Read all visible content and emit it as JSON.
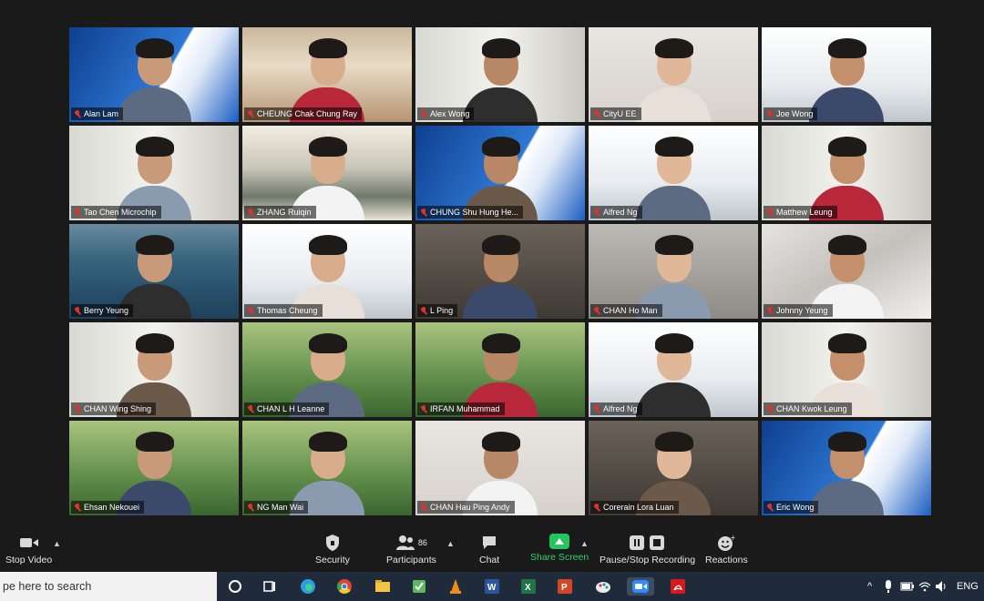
{
  "participants": [
    {
      "name": "Alan Lam",
      "bg": "ee",
      "active": true
    },
    {
      "name": "CHEUNG Chak Chung Ray",
      "bg": "shelf"
    },
    {
      "name": "Alex Wong",
      "bg": "office"
    },
    {
      "name": "CityU EE",
      "bg": "wall"
    },
    {
      "name": "Joe Wong",
      "bg": "window"
    },
    {
      "name": "Tao Chen  Microchip",
      "bg": "office"
    },
    {
      "name": "ZHANG Ruiqin",
      "bg": "painting"
    },
    {
      "name": "CHUNG Shu Hung He...",
      "bg": "ee"
    },
    {
      "name": "Alfred Ng",
      "bg": "window"
    },
    {
      "name": "Matthew Leung",
      "bg": "office"
    },
    {
      "name": "Berry Yeung",
      "bg": "sea"
    },
    {
      "name": "Thomas Cheung",
      "bg": "window"
    },
    {
      "name": "L Ping",
      "bg": "dark"
    },
    {
      "name": "CHAN Ho Man",
      "bg": "grey"
    },
    {
      "name": "Johnny Yeung",
      "bg": "dune"
    },
    {
      "name": "CHAN Wing Shing",
      "bg": "office"
    },
    {
      "name": "CHAN L H Leanne",
      "bg": "green"
    },
    {
      "name": "IRFAN Muhammad",
      "bg": "green"
    },
    {
      "name": "Alfred Ng",
      "bg": "window"
    },
    {
      "name": "CHAN Kwok Leung",
      "bg": "office"
    },
    {
      "name": "Ehsan Nekouei",
      "bg": "green"
    },
    {
      "name": "NG Man Wai",
      "bg": "green"
    },
    {
      "name": "CHAN Hau Ping Andy",
      "bg": "wall"
    },
    {
      "name": "Corerain Lora Luan",
      "bg": "dark"
    },
    {
      "name": "Eric Wong",
      "bg": "ee"
    }
  ],
  "toolbar": {
    "stop_video": "Stop Video",
    "security": "Security",
    "participants": "Participants",
    "participants_count": "86",
    "chat": "Chat",
    "share_screen": "Share Screen",
    "recording": "Pause/Stop Recording",
    "reactions": "Reactions"
  },
  "taskbar": {
    "search_placeholder": "pe here to search",
    "language": "ENG"
  },
  "colors": {
    "share_green": "#22c55e",
    "active_speaker": "#f0d24a",
    "muted_red": "#e2302b"
  }
}
